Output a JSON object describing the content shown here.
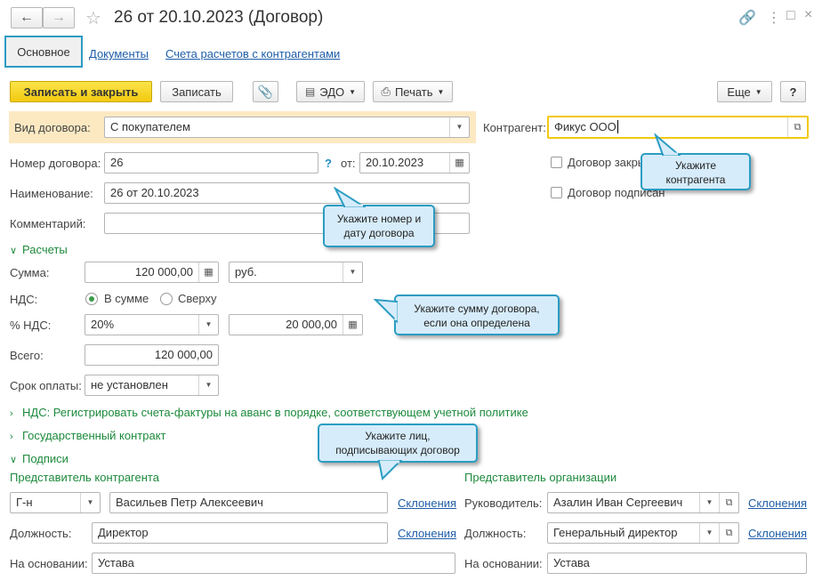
{
  "window": {
    "title": "26 от 20.10.2023 (Договор)",
    "back_icon": "arrow-left-icon",
    "forward_icon": "arrow-right-icon",
    "star_icon": "star-icon",
    "link_icon": "link-icon",
    "more_icon": "more-vertical-icon",
    "maximize_icon": "maximize-icon",
    "close_icon": "close-icon"
  },
  "tabs": [
    {
      "label": "Основное",
      "active": true
    },
    {
      "label": "Документы"
    },
    {
      "label": "Счета расчетов с контрагентами"
    }
  ],
  "toolbar": {
    "save_close": "Записать и закрыть",
    "save": "Записать",
    "edo": "ЭДО",
    "print": "Печать",
    "more": "Еще",
    "help": "?"
  },
  "form": {
    "contract_type_label": "Вид договора:",
    "contract_type_value": "С покупателем",
    "counterparty_label": "Контрагент:",
    "counterparty_value": "Фикус ООО",
    "number_label": "Номер договора:",
    "number_value": "26",
    "number_help": "?",
    "date_label": "от:",
    "date_value": "20.10.2023",
    "contract_closed_label": "Договор закрыт",
    "contract_signed_label": "Договор подписан",
    "name_label": "Наименование:",
    "name_value": "26 от 20.10.2023",
    "comment_label": "Комментарий:",
    "comment_value": ""
  },
  "payments": {
    "section_label": "Расчеты",
    "sum_label": "Сумма:",
    "sum_value": "120 000,00",
    "currency_value": "руб.",
    "vat_label": "НДС:",
    "vat_in_sum": "В сумме",
    "vat_on_top": "Сверху",
    "vat_rate_label": "% НДС:",
    "vat_rate_value": "20%",
    "vat_amount_value": "20 000,00",
    "total_label": "Всего:",
    "total_value": "120 000,00",
    "term_label": "Срок оплаты:",
    "term_value": "не установлен"
  },
  "sections": {
    "vat_policy": "НДС: Регистрировать счета-фактуры на аванс в порядке, соответствующем учетной политике",
    "state_contract": "Государственный контракт",
    "signatures": "Подписи"
  },
  "signatures": {
    "counterparty_rep_title": "Представитель контрагента",
    "salutation": "Г-н",
    "counterparty_rep_name": "Васильев Петр Алексеевич",
    "declensions": "Склонения",
    "position_label": "Должность:",
    "counterparty_position": "Директор",
    "basis_label": "На основании:",
    "counterparty_basis": "Устава",
    "org_rep_title": "Представитель организации",
    "head_label": "Руководитель:",
    "org_head": "Азалин Иван Сергеевич",
    "org_position": "Генеральный директор",
    "org_basis": "Устава"
  },
  "tooltips": {
    "counterparty": "Укажите контрагента",
    "number_date": "Укажите номер и дату договора",
    "sum": "Укажите сумму договора, если она определена",
    "signers": "Укажите лиц, подписывающих договор"
  },
  "colors": {
    "accent_yellow": "#f2c90f",
    "section_green": "#1d8a3c",
    "link_blue": "#1f5ea8",
    "tooltip_border": "#2b9cc2",
    "tooltip_bg": "#d6ecfa",
    "highlight_row": "#fce9c2"
  }
}
